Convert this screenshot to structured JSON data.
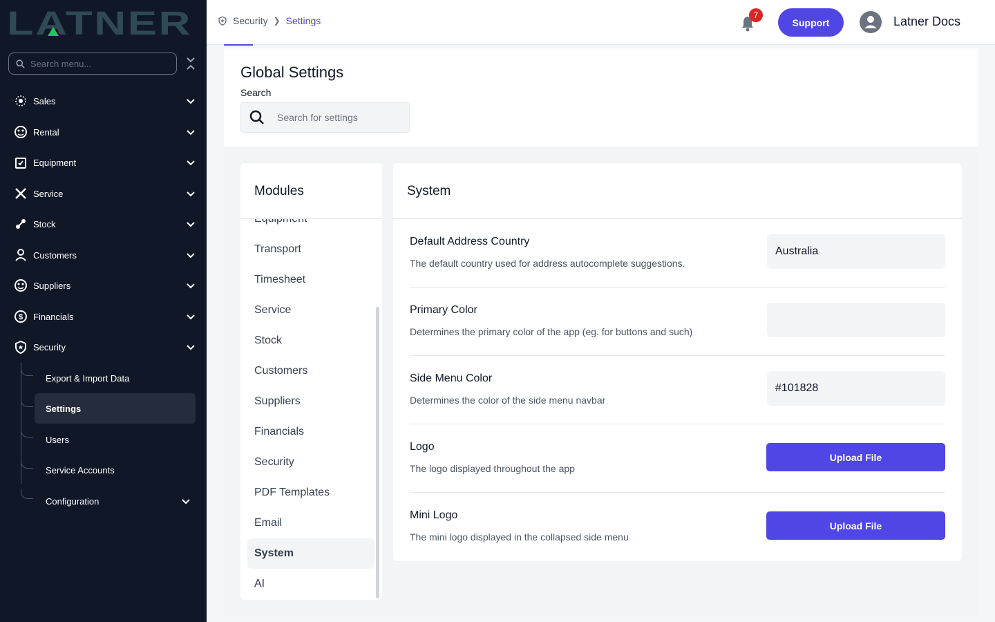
{
  "app": {
    "logo_text": "LATNER"
  },
  "sidebar": {
    "search_placeholder": "Search menu...",
    "items": [
      {
        "label": "Sales",
        "icon": "sales-icon"
      },
      {
        "label": "Rental",
        "icon": "rental-icon"
      },
      {
        "label": "Equipment",
        "icon": "equipment-icon"
      },
      {
        "label": "Service",
        "icon": "service-icon"
      },
      {
        "label": "Stock",
        "icon": "stock-icon"
      },
      {
        "label": "Customers",
        "icon": "customers-icon"
      },
      {
        "label": "Suppliers",
        "icon": "suppliers-icon"
      },
      {
        "label": "Financials",
        "icon": "financials-icon"
      },
      {
        "label": "Security",
        "icon": "shield-icon"
      }
    ],
    "security_sub": [
      {
        "label": "Export & Import Data"
      },
      {
        "label": "Settings",
        "active": true
      },
      {
        "label": "Users"
      },
      {
        "label": "Service Accounts"
      },
      {
        "label": "Configuration"
      }
    ]
  },
  "topbar": {
    "breadcrumb": [
      "Security",
      "Settings"
    ],
    "notification_count": "7",
    "support_label": "Support",
    "user_name": "Latner Docs"
  },
  "header": {
    "title": "Global Settings",
    "search_label": "Search",
    "search_placeholder": "Search for settings"
  },
  "modules": {
    "title": "Modules",
    "items": [
      "Equipment",
      "Transport",
      "Timesheet",
      "Service",
      "Stock",
      "Customers",
      "Suppliers",
      "Financials",
      "Security",
      "PDF Templates",
      "Email",
      "System",
      "AI"
    ],
    "active": "System"
  },
  "system": {
    "title": "System",
    "settings": [
      {
        "name": "Default Address Country",
        "description": "The default country used for address autocomplete suggestions.",
        "type": "input",
        "value": "Australia"
      },
      {
        "name": "Primary Color",
        "description": "Determines the primary color of the app (eg. for buttons and such)",
        "type": "input",
        "value": ""
      },
      {
        "name": "Side Menu Color",
        "description": "Determines the color of the side menu navbar",
        "type": "input",
        "value": "#101828"
      },
      {
        "name": "Logo",
        "description": "The logo displayed throughout the app",
        "type": "upload",
        "button": "Upload File"
      },
      {
        "name": "Mini Logo",
        "description": "The mini logo displayed in the collapsed side menu",
        "type": "upload",
        "button": "Upload File"
      }
    ]
  },
  "colors": {
    "accent": "#4f46e5",
    "sidebar_bg": "#101828",
    "logo": "#2f4a52",
    "logo_accent": "#22c55e",
    "badge": "#dc2626"
  }
}
